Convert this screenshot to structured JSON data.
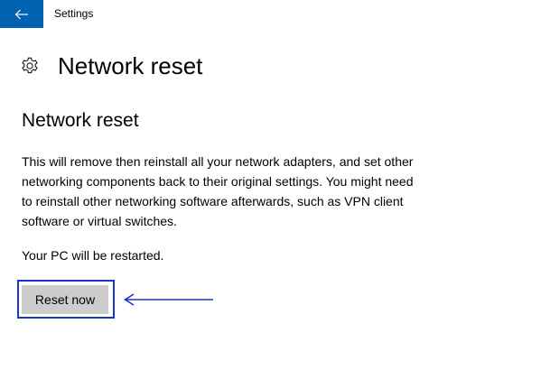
{
  "window": {
    "app_title": "Settings",
    "accent_color": "#0063b1"
  },
  "titlebar": {
    "back_icon": "arrow-left-icon"
  },
  "header": {
    "icon": "gear-icon",
    "title": "Network reset"
  },
  "content": {
    "section_title": "Network reset",
    "description": "This will remove then reinstall all your network adapters, and set other networking components back to their original settings. You might need to reinstall other networking software afterwards, such as VPN client software or virtual switches.",
    "restart_note": "Your PC will be restarted.",
    "reset_button_label": "Reset now"
  },
  "annotation": {
    "highlight_color": "#1a35c8",
    "arrow_icon": "arrow-left-icon"
  }
}
